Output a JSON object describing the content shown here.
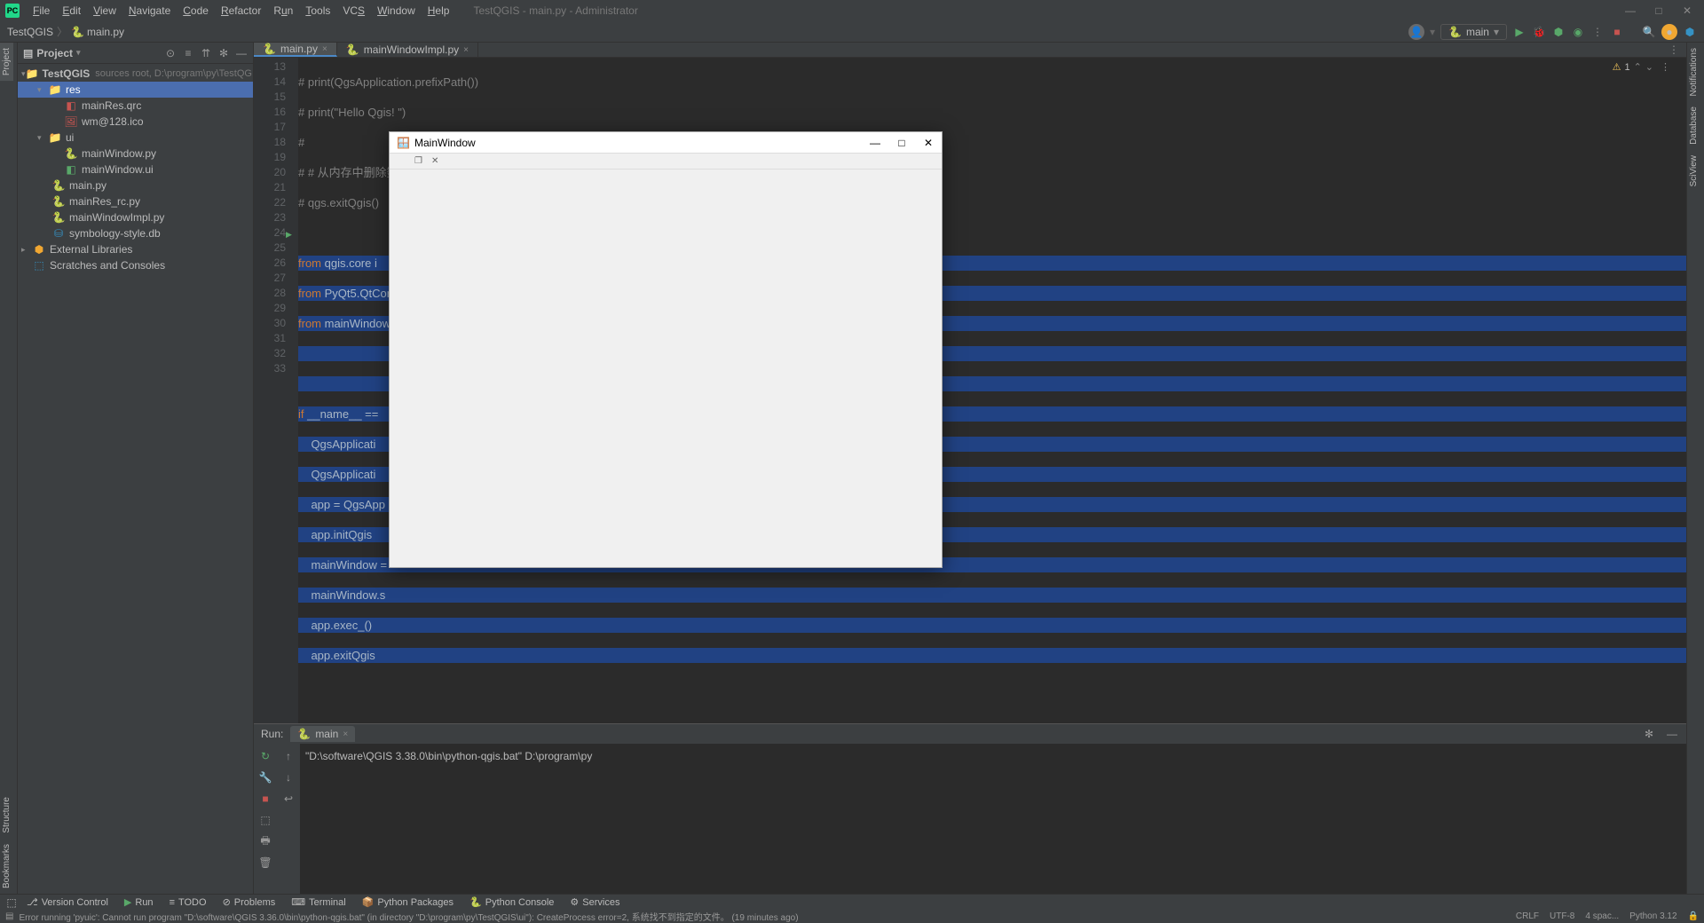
{
  "title": "TestQGIS - main.py - Administrator",
  "menus": [
    "File",
    "Edit",
    "View",
    "Navigate",
    "Code",
    "Refactor",
    "Run",
    "Tools",
    "VCS",
    "Window",
    "Help"
  ],
  "nav": {
    "crumb1": "TestQGIS",
    "crumb2": "main.py"
  },
  "runConfig": "main",
  "project": {
    "title": "Project",
    "root": "TestQGIS",
    "rootHint": "sources root, D:\\program\\py\\TestQGIS",
    "res": "res",
    "mainRes": "mainRes.qrc",
    "wmico": "wm@128.ico",
    "ui": "ui",
    "mainWindowPy": "mainWindow.py",
    "mainWindowUi": "mainWindow.ui",
    "mainpy": "main.py",
    "mainResRc": "mainRes_rc.py",
    "mainWindowImpl": "mainWindowImpl.py",
    "symbology": "symbology-style.db",
    "extLibs": "External Libraries",
    "scratches": "Scratches and Consoles"
  },
  "tabs": {
    "main": "main.py",
    "impl": "mainWindowImpl.py"
  },
  "gutter": [
    "13",
    "14",
    "15",
    "16",
    "17",
    "18",
    "19",
    "20",
    "21",
    "22",
    "23",
    "24",
    "25",
    "26",
    "27",
    "28",
    "29",
    "30",
    "31",
    "32",
    "33"
  ],
  "code": {
    "l13": "# print(QgsApplication.prefixPath())",
    "l14": "# print(\"Hello Qgis! \")",
    "l15": "#",
    "l16": "# # 从内存中删除数据提供程序和层注册表来结束",
    "l17": "# qgs.exitQgis()",
    "l18": "",
    "l19a": "from",
    "l19b": " qgis.core i",
    "l20a": "from",
    "l20b": " PyQt5.QtCor",
    "l21a": "from",
    "l21b": " mainWindowI",
    "l22": "",
    "l23": "",
    "l24a": "if",
    "l24b": " __name__ == ",
    "l25": "    QgsApplicati",
    "l26": "    QgsApplicati",
    "l27": "    app = QgsApp",
    "l28": "    app.initQgis",
    "l29": "    mainWindow =",
    "l30": "    mainWindow.s",
    "l31": "    app.exec_()",
    "l32": "    app.exitQgis",
    "l33": ""
  },
  "warnCount": "1",
  "runLabel": "Run:",
  "runTab": "main",
  "console": "\"D:\\software\\QGIS 3.38.0\\bin\\python-qgis.bat\" D:\\program\\py",
  "bottomTools": {
    "vc": "Version Control",
    "run": "Run",
    "todo": "TODO",
    "problems": "Problems",
    "terminal": "Terminal",
    "pypkg": "Python Packages",
    "pycon": "Python Console",
    "services": "Services"
  },
  "status": {
    "msg": "Error running 'pyuic': Cannot run program \"D:\\software\\QGIS 3.36.0\\bin\\python-qgis.bat\" (in directory \"D:\\program\\py\\TestQGIS\\ui\"): CreateProcess error=2, 系统找不到指定的文件。 (19 minutes ago)",
    "crlf": "CRLF",
    "enc": "UTF-8",
    "indent": "4 spac...",
    "py": "Python 3.12"
  },
  "leftStripe": {
    "project": "Project"
  },
  "leftBottom": {
    "structure": "Structure",
    "bookmarks": "Bookmarks"
  },
  "rightStripe": {
    "notif": "Notifications",
    "db": "Database",
    "sci": "SciView"
  },
  "popup": {
    "title": "MainWindow"
  }
}
